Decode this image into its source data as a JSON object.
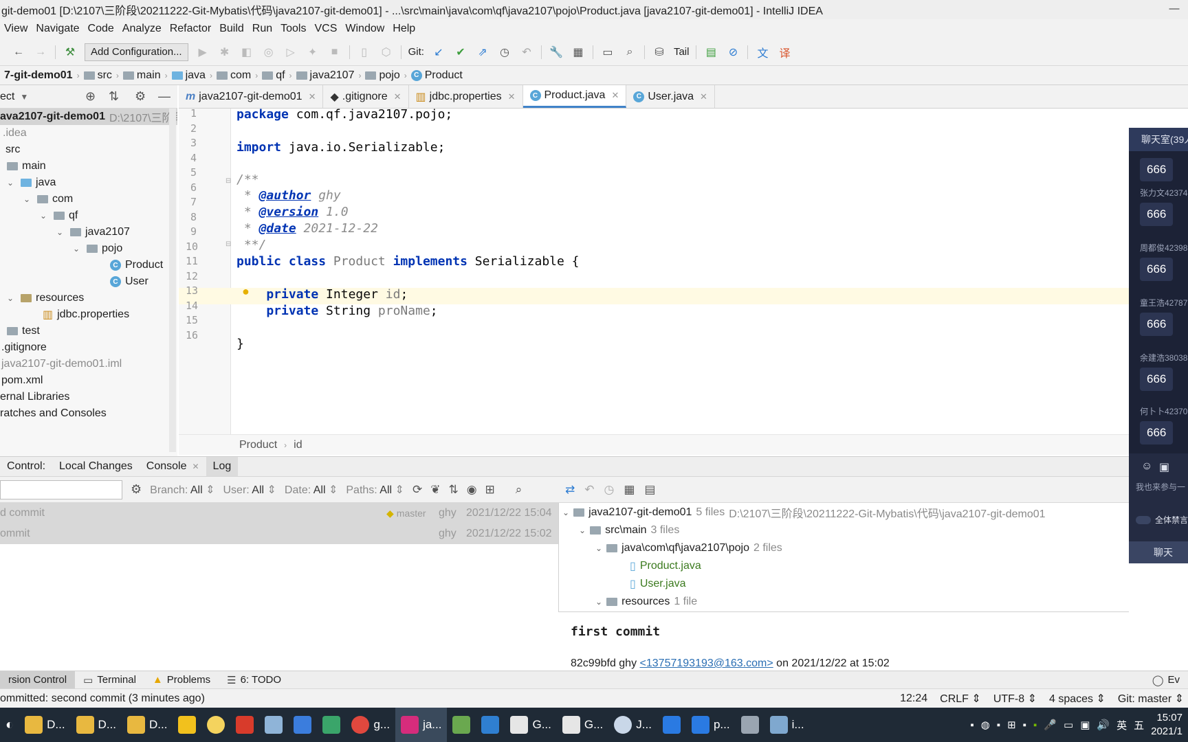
{
  "title": {
    "text": "git-demo01 [D:\\2107\\三阶段\\20211222-Git-Mybatis\\代码\\java2107-git-demo01] - ...\\src\\main\\java\\com\\qf\\java2107\\pojo\\Product.java [java2107-git-demo01] - IntelliJ IDEA",
    "minimize": "—",
    "maximize": "❐",
    "close": "✕"
  },
  "menu": [
    "View",
    "Navigate",
    "Code",
    "Analyze",
    "Refactor",
    "Build",
    "Run",
    "Tools",
    "VCS",
    "Window",
    "Help"
  ],
  "toolbar": {
    "add_configuration": "Add Configuration...",
    "git_label": "Git:",
    "tail_label": "Tail"
  },
  "breadcrumb": {
    "project": "7-git-demo01",
    "items": [
      "src",
      "main",
      "java",
      "com",
      "qf",
      "java2107",
      "pojo",
      "Product"
    ]
  },
  "project_panel": {
    "header": "ect",
    "tree": [
      {
        "label": "ava2107-git-demo01",
        "path": "D:\\2107\\三阶段"
      },
      {
        "label": ".idea"
      },
      {
        "label": "src"
      },
      {
        "label": "main"
      },
      {
        "label": "java"
      },
      {
        "label": "com"
      },
      {
        "label": "qf"
      },
      {
        "label": "java2107"
      },
      {
        "label": "pojo"
      },
      {
        "label": "Product"
      },
      {
        "label": "User"
      },
      {
        "label": "resources"
      },
      {
        "label": "jdbc.properties"
      },
      {
        "label": "test"
      },
      {
        "label": ".gitignore"
      },
      {
        "label": "java2107-git-demo01.iml"
      },
      {
        "label": "pom.xml"
      },
      {
        "label": "ernal Libraries"
      },
      {
        "label": "ratches and Consoles"
      }
    ]
  },
  "tabs": [
    {
      "label": "java2107-git-demo01",
      "icon": "m-icon"
    },
    {
      "label": ".gitignore",
      "icon": "git-icon"
    },
    {
      "label": "jdbc.properties",
      "icon": "properties-icon"
    },
    {
      "label": "Product.java",
      "icon": "class-icon",
      "active": true
    },
    {
      "label": "User.java",
      "icon": "class-icon"
    }
  ],
  "editor": {
    "line_numbers": [
      "1",
      "2",
      "3",
      "4",
      "5",
      "6",
      "7",
      "8",
      "9",
      "10",
      "11",
      "12",
      "13",
      "14",
      "15",
      "16"
    ],
    "lines": {
      "l1_kw": "package",
      "l1_rest": " com.qf.java2107.pojo;",
      "l3_kw": "import",
      "l3_rest": " java.io.Serializable;",
      "l5": "/**",
      "l6_pre": " * ",
      "l6_tag": "@author",
      "l6_val": " ghy",
      "l7_pre": " * ",
      "l7_tag": "@version",
      "l7_val": " 1.0",
      "l8_pre": " * ",
      "l8_tag": "@date",
      "l8_val": " 2021-12-22",
      "l9": " **/",
      "l10_kw1": "public class",
      "l10_name": " Product ",
      "l10_kw2": "implements",
      "l10_rest": " Serializable {",
      "l12_kw": "    private",
      "l12_type": " Integer ",
      "l12_field": "id",
      "l12_end": ";",
      "l13_kw": "    private",
      "l13_type": " String ",
      "l13_field": "proName",
      "l13_end": ";",
      "l15": "}"
    },
    "crumbs": [
      "Product",
      "id"
    ]
  },
  "vcs": {
    "tabs": [
      "Control:",
      "Local Changes",
      "Console",
      "Log"
    ],
    "filters": {
      "branch_label": "Branch:",
      "branch_value": "All",
      "user_label": "User:",
      "user_value": "All",
      "date_label": "Date:",
      "date_value": "All",
      "paths_label": "Paths:",
      "paths_value": "All"
    },
    "commits": [
      {
        "message": "d commit",
        "branch": "master",
        "author": "ghy",
        "date": "2021/12/22 15:04"
      },
      {
        "message": "ommit",
        "author": "ghy",
        "date": "2021/12/22 15:02"
      }
    ],
    "files_tree": [
      {
        "label": "java2107-git-demo01",
        "count": "5 files",
        "path": "D:\\2107\\三阶段\\20211222-Git-Mybatis\\代码\\java2107-git-demo01"
      },
      {
        "label": "src\\main",
        "count": "3 files"
      },
      {
        "label": "java\\com\\qf\\java2107\\pojo",
        "count": "2 files"
      },
      {
        "label": "Product.java"
      },
      {
        "label": "User.java"
      },
      {
        "label": "resources",
        "count": "1 file"
      }
    ],
    "detail": {
      "title": "first commit",
      "hash_author": "82c99bfd ghy",
      "email": "<13757193193@163.com>",
      "on_date": "on 2021/12/22 at 15:02"
    }
  },
  "toolwindows": [
    "rsion Control",
    "Terminal",
    "Problems",
    "6: TODO",
    "Ev"
  ],
  "status": {
    "message": "ommitted: second commit (3 minutes ago)",
    "position": "12:24",
    "line_sep": "CRLF",
    "encoding": "UTF-8",
    "indent": "4 spaces",
    "git_branch": "Git: master"
  },
  "taskbar": {
    "items": [
      "D...",
      "D...",
      "D...",
      "",
      "",
      "",
      "",
      "",
      "",
      "g...",
      "ja...",
      "",
      "",
      "G...",
      "G...",
      "J...",
      "",
      "p...",
      "",
      "i...",
      ""
    ],
    "ime": "英",
    "ime2": "五",
    "time": "15:07",
    "date": "2021/1"
  },
  "chat": {
    "header": "聊天室(39人",
    "messages": [
      {
        "name": "",
        "text": "666"
      },
      {
        "name": "张力文42374",
        "text": "666"
      },
      {
        "name": "周都俊42398",
        "text": "666"
      },
      {
        "name": "童王浩42787",
        "text": "666"
      },
      {
        "name": "余建浩38038",
        "text": "666"
      },
      {
        "name": "何卜卜42370",
        "text": "666"
      }
    ],
    "join_text": "我也来参与一",
    "mute_all": "全体禁言",
    "send": "聊天"
  },
  "colors": {
    "accent": "#4083c9",
    "keyword": "#0033b3",
    "comment": "#8c8c8c",
    "field": "#871094",
    "vcs_added": "#3b7a1e",
    "chat_bg": "#1c2236",
    "taskbar_bg": "#1f2a36"
  }
}
